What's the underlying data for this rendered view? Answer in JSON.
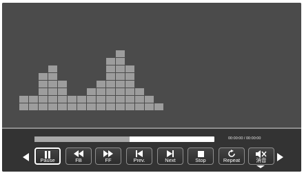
{
  "player": {
    "progress_fraction": 0.53,
    "time_display": "00:00:00 / 00:00:00"
  },
  "equalizer": {
    "bar_levels": [
      2,
      2,
      5,
      6,
      4,
      2,
      2,
      3,
      4,
      7,
      8,
      6,
      3,
      2,
      1
    ]
  },
  "controls": {
    "buttons": [
      {
        "label": "Pause",
        "icon": "pause-icon",
        "selected": true
      },
      {
        "label": "FB",
        "icon": "fast-backward-icon"
      },
      {
        "label": "FF",
        "icon": "fast-forward-icon"
      },
      {
        "label": "Prev.",
        "icon": "previous-track-icon"
      },
      {
        "label": "Next",
        "icon": "next-track-icon"
      },
      {
        "label": "Stop",
        "icon": "stop-icon"
      },
      {
        "label": "Repeat",
        "icon": "repeat-icon"
      },
      {
        "label": "消音",
        "icon": "mute-icon"
      }
    ]
  },
  "colors": {
    "background": "#4a4a4a",
    "equalizer_cell": "#9d9d9d",
    "control_bar": "#333333",
    "selection": "#ffffff"
  }
}
